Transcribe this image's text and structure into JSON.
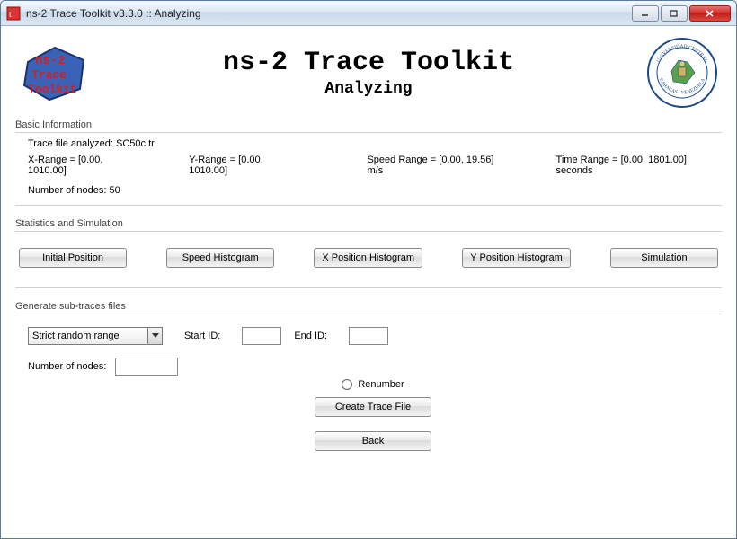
{
  "window": {
    "title": "ns-2 Trace Toolkit v3.3.0 :: Analyzing"
  },
  "header": {
    "app_title": "ns-2 Trace Toolkit",
    "subtitle": "Analyzing",
    "logo_left_text_top": "ns-2",
    "logo_left_text_mid": "Trace",
    "logo_left_text_bot": "Toolkit",
    "seal_top": "UNIVERSIDAD CENTRAL",
    "seal_bottom": "CARACAS · VENEZUELA"
  },
  "basic_info": {
    "section_label": "Basic Information",
    "trace_file": "Trace file analyzed: SC50c.tr",
    "x_range": "X-Range = [0.00, 1010.00]",
    "y_range": "Y-Range = [0.00, 1010.00]",
    "speed_range": "Speed Range = [0.00, 19.56] m/s",
    "time_range": "Time Range = [0.00, 1801.00] seconds",
    "num_nodes": "Number of nodes: 50"
  },
  "stats": {
    "section_label": "Statistics and Simulation",
    "buttons": {
      "initial_position": "Initial Position",
      "speed_histogram": "Speed Histogram",
      "x_position_histogram": "X Position Histogram",
      "y_position_histogram": "Y Position Histogram",
      "simulation": "Simulation"
    }
  },
  "generate": {
    "section_label": "Generate sub-traces files",
    "dropdown_selected": "Strict random range",
    "start_id_label": "Start ID:",
    "end_id_label": "End ID:",
    "start_id_value": "",
    "end_id_value": "",
    "num_nodes_label": "Number of nodes:",
    "num_nodes_value": "",
    "renumber_label": "Renumber",
    "create_btn": "Create Trace File",
    "back_btn": "Back"
  }
}
